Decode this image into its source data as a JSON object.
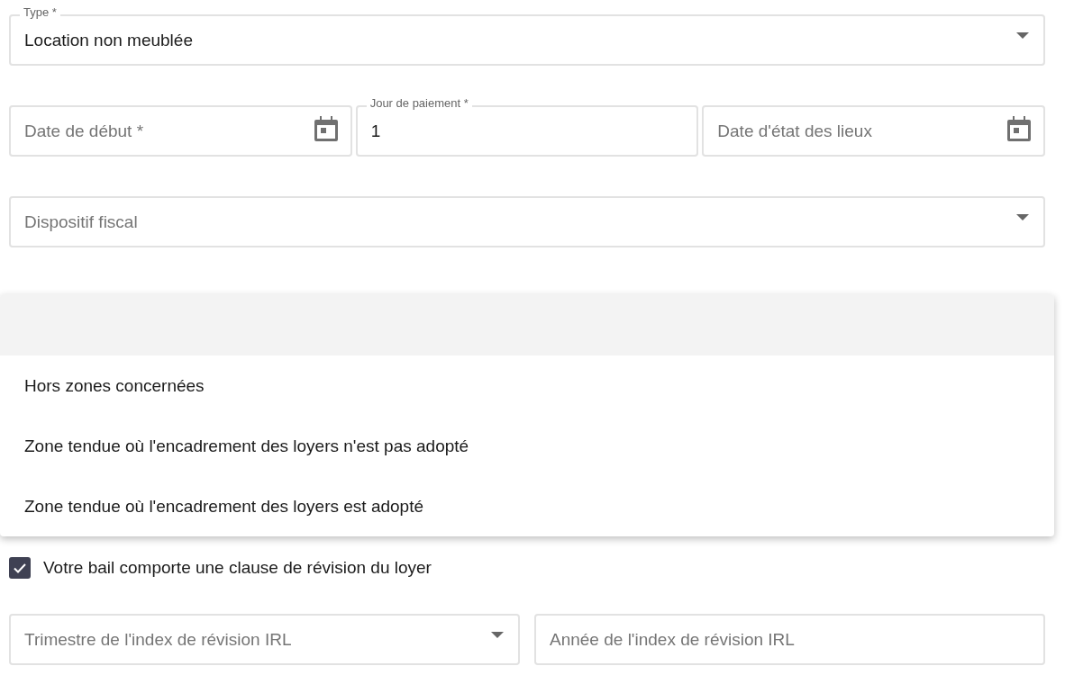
{
  "rows": [
    [
      {
        "kind": "select",
        "label": "Type *",
        "value": "Location non meublée"
      }
    ],
    [
      {
        "kind": "date",
        "placeholder": "Date de début *"
      },
      {
        "kind": "text",
        "label": "Jour de paiement *",
        "value": "1"
      },
      {
        "kind": "date",
        "placeholder": "Date d'état des lieux"
      }
    ],
    [
      {
        "kind": "select",
        "placeholder": "Dispositif fiscal"
      }
    ]
  ],
  "menu": {
    "empty_option_highlighted": true,
    "options": [
      {
        "label": "Hors zones concernées"
      },
      {
        "label": "Zone tendue où l'encadrement des loyers n'est pas adopté"
      },
      {
        "label": "Zone tendue où l'encadrement des loyers est adopté"
      }
    ]
  },
  "checkbox": {
    "label": "Votre bail comporte une clause de révision du loyer",
    "checked": true
  },
  "bottom_row": [
    {
      "kind": "select",
      "placeholder": "Trimestre de l'index de révision IRL"
    },
    {
      "kind": "text",
      "placeholder": "Année de l'index de révision IRL"
    }
  ]
}
